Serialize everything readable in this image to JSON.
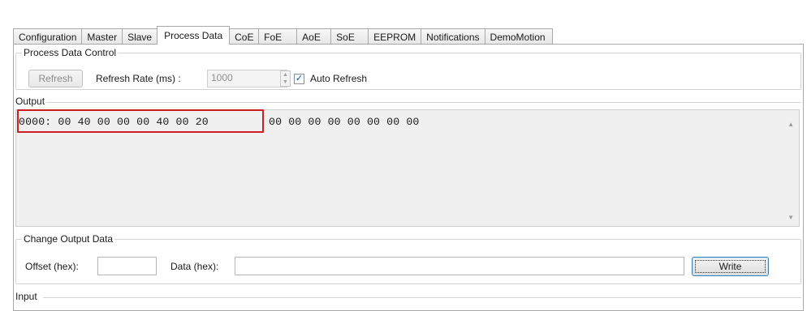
{
  "tabs": [
    {
      "label": "Configuration",
      "active": false
    },
    {
      "label": "Master",
      "active": false
    },
    {
      "label": "Slave",
      "active": false
    },
    {
      "label": "Process Data",
      "active": true
    },
    {
      "label": "CoE",
      "active": false
    },
    {
      "label": "FoE",
      "active": false
    },
    {
      "label": "AoE",
      "active": false
    },
    {
      "label": "SoE",
      "active": false
    },
    {
      "label": "EEPROM",
      "active": false
    },
    {
      "label": "Notifications",
      "active": false
    },
    {
      "label": "DemoMotion",
      "active": false
    }
  ],
  "process_data_control": {
    "title": "Process Data Control",
    "refresh_button": "Refresh",
    "refresh_rate_label": "Refresh Rate (ms) :",
    "refresh_rate_value": "1000",
    "auto_refresh_label": "Auto Refresh",
    "auto_refresh_checked": true
  },
  "output": {
    "title": "Output",
    "line_highlighted": "0000: 00 40 00 00 00 40 00 20",
    "line_rest": "00 00 00 00 00 00 00 00"
  },
  "change_output": {
    "title": "Change Output Data",
    "offset_label": "Offset (hex):",
    "offset_value": "",
    "data_label": "Data (hex):",
    "data_value": "",
    "write_button": "Write"
  },
  "input": {
    "title": "Input"
  },
  "colors": {
    "highlight_border": "#cc1f25",
    "output_background": "#f0f0f0"
  }
}
